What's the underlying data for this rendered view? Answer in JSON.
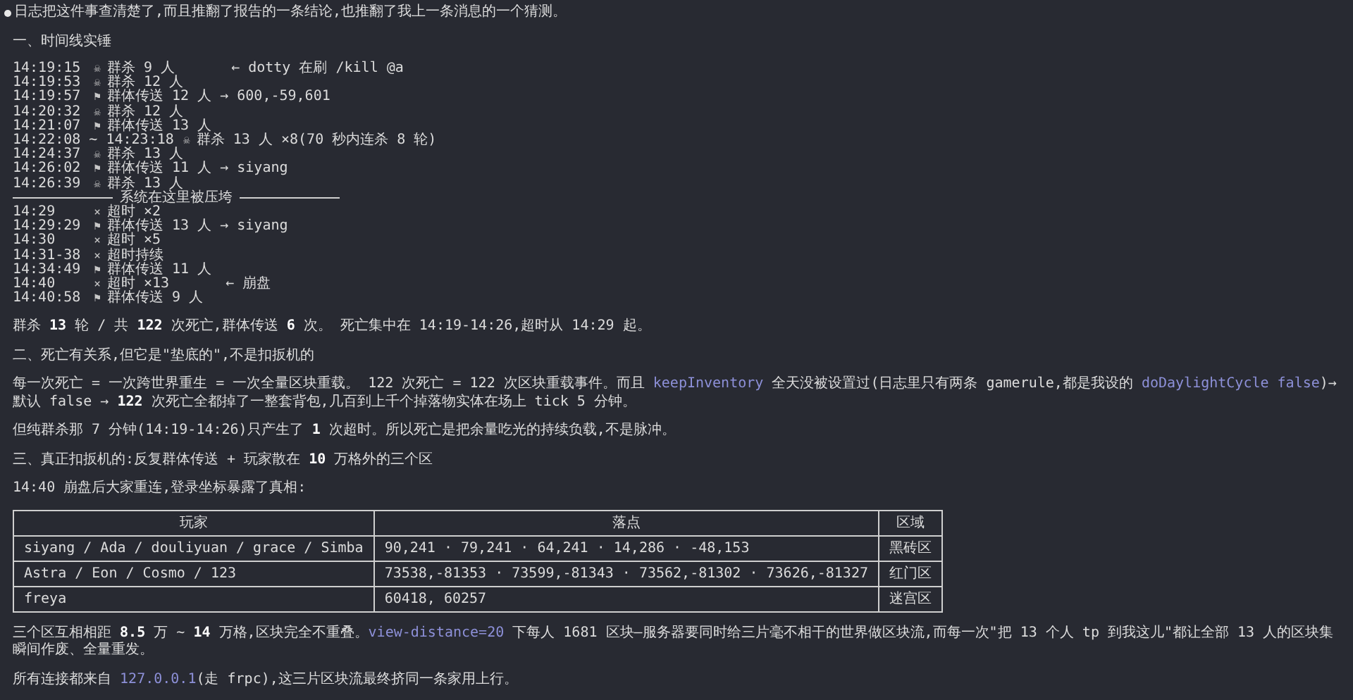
{
  "message": {
    "lead": "日志把这件事查清楚了,而且推翻了报告的一条结论,也推翻了我上一条消息的一个猜测。",
    "blocks": [
      {
        "kind": "paragraph",
        "segments": [
          {
            "kind": "text",
            "text": "一、时间线实锤"
          }
        ]
      },
      {
        "kind": "timeline",
        "entries": [
          {
            "kind": "entry",
            "time": "14:19:15",
            "marker": "☠",
            "text": "群杀 9 人",
            "note": "← dotty 在刷 /kill @a"
          },
          {
            "kind": "entry",
            "time": "14:19:53",
            "marker": "☠",
            "text": "群杀 12 人"
          },
          {
            "kind": "entry",
            "time": "14:19:57",
            "marker": "⚑",
            "text": "群体传送 12 人 → 600,-59,601"
          },
          {
            "kind": "entry",
            "time": "14:20:32",
            "marker": "☠",
            "text": "群杀 12 人"
          },
          {
            "kind": "entry",
            "time": "14:21:07",
            "marker": "⚑",
            "text": "群体传送 13 人"
          },
          {
            "kind": "entry",
            "time": "14:22:08 ~ 14:23:18",
            "marker": "☠",
            "text": "群杀 13 人 ×8(70 秒内连杀 8 轮)"
          },
          {
            "kind": "entry",
            "time": "14:24:37",
            "marker": "☠",
            "text": "群杀 13 人"
          },
          {
            "kind": "entry",
            "time": "14:26:02",
            "marker": "⚑",
            "text": "群体传送 11 人 → siyang"
          },
          {
            "kind": "entry",
            "time": "14:26:39",
            "marker": "☠",
            "text": "群杀 13 人"
          },
          {
            "kind": "divider",
            "text": "系统在这里被压垮"
          },
          {
            "kind": "entry",
            "time": "14:29",
            "marker": "×",
            "text": "超时 ×2"
          },
          {
            "kind": "entry",
            "time": "14:29:29",
            "marker": "⚑",
            "text": "群体传送 13 人 → siyang"
          },
          {
            "kind": "entry",
            "time": "14:30",
            "marker": "×",
            "text": "超时 ×5"
          },
          {
            "kind": "entry",
            "time": "14:31-38",
            "marker": "×",
            "text": "超时持续"
          },
          {
            "kind": "entry",
            "time": "14:34:49",
            "marker": "⚑",
            "text": "群体传送 11 人"
          },
          {
            "kind": "entry",
            "time": "14:40",
            "marker": "×",
            "text": "超时 ×13",
            "note": "← 崩盘"
          },
          {
            "kind": "entry",
            "time": "14:40:58",
            "marker": "⚑",
            "text": "群体传送 9 人"
          }
        ]
      },
      {
        "kind": "paragraph",
        "segments": [
          {
            "kind": "text",
            "text": "群杀 **13** 轮 / 共 **122** 次死亡,群体传送 **6** 次。 死亡集中在 14:19-14:26,超时从 14:29 起。"
          }
        ]
      },
      {
        "kind": "paragraph",
        "segments": [
          {
            "kind": "text",
            "text": "二、死亡有关系,但它是\"垫底的\",不是扣扳机的"
          }
        ]
      },
      {
        "kind": "paragraph",
        "segments": [
          {
            "kind": "text",
            "text": "每一次死亡 = 一次跨世界重生 = 一次全量区块重载。 122 次死亡 = 122 次区块重载事件。而且 "
          },
          {
            "kind": "code",
            "text": "keepInventory"
          },
          {
            "kind": "text",
            "text": " 全天没被设置过(日志里只有两条 gamerule,都是我设的 "
          },
          {
            "kind": "code",
            "text": "doDaylightCycle false"
          },
          {
            "kind": "text",
            "text": ")→ 默认 false → **122** 次死亡全都掉了一整套背包,几百到上千个掉落物实体在场上 tick 5 分钟。"
          }
        ]
      },
      {
        "kind": "paragraph",
        "segments": [
          {
            "kind": "text",
            "text": "但纯群杀那 7 分钟(14:19-14:26)只产生了 **1** 次超时。所以死亡是把余量吃光的持续负载,不是脉冲。"
          }
        ]
      },
      {
        "kind": "paragraph",
        "segments": [
          {
            "kind": "text",
            "text": "三、真正扣扳机的:反复群体传送 + 玩家散在 **10** 万格外的三个区"
          }
        ]
      },
      {
        "kind": "paragraph",
        "segments": [
          {
            "kind": "text",
            "text": "14:40 崩盘后大家重连,登录坐标暴露了真相:"
          }
        ]
      },
      {
        "kind": "table",
        "columns": [
          "玩家",
          "落点",
          "区域"
        ],
        "rows": [
          [
            "siyang / Ada / douliyuan / grace / Simba",
            "90,241 · 79,241 · 64,241 · 14,286 · -48,153",
            "黑砖区"
          ],
          [
            "Astra / Eon / Cosmo / 123",
            "73538,-81353 · 73599,-81343 · 73562,-81302 · 73626,-81327",
            "红门区"
          ],
          [
            "freya",
            "60418, 60257",
            "迷宫区"
          ]
        ]
      },
      {
        "kind": "paragraph",
        "segments": [
          {
            "kind": "text",
            "text": "三个区互相相距 **8.5** 万 ~ **14** 万格,区块完全不重叠。"
          },
          {
            "kind": "code",
            "text": "view-distance=20"
          },
          {
            "kind": "text",
            "text": " 下每人 1681 区块—服务器要同时给三片毫不相干的世界做区块流,而每一次\"把 13 个人 tp 到我这儿\"都让全部 13 人的区块集瞬间作废、全量重发。"
          }
        ]
      },
      {
        "kind": "paragraph",
        "segments": [
          {
            "kind": "text",
            "text": "所有连接都来自 "
          },
          {
            "kind": "code",
            "text": "127.0.0.1"
          },
          {
            "kind": "text",
            "text": "(走 frpc),这三片区块流最终挤同一条家用上行。"
          }
        ]
      }
    ]
  }
}
